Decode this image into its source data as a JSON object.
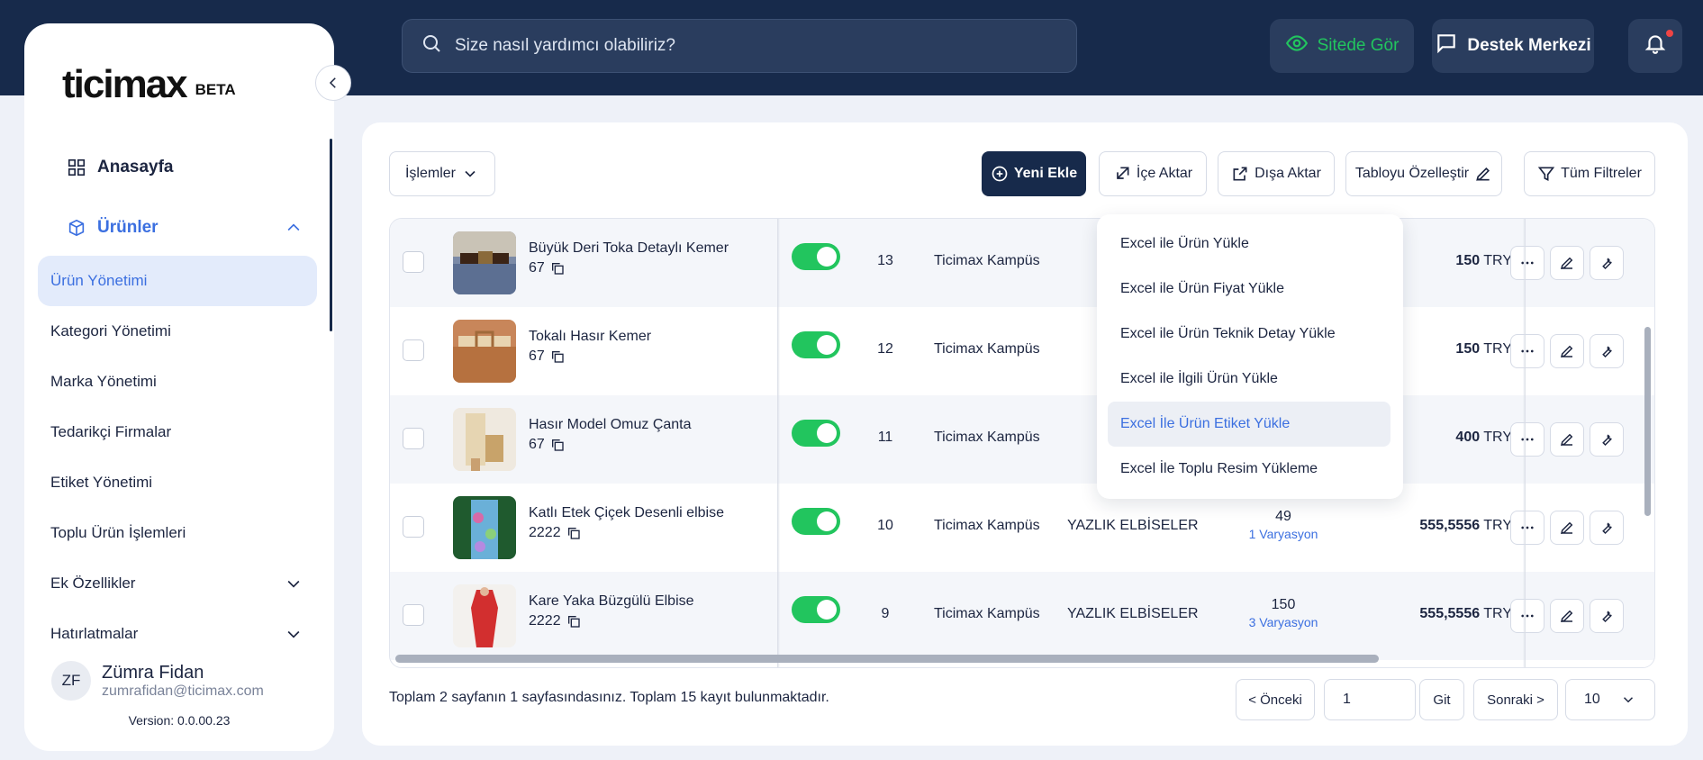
{
  "header": {
    "search_placeholder": "Size nasıl yardımcı olabiliriz?",
    "site_button": "Sitede Gör",
    "support_button": "Destek Merkezi"
  },
  "sidebar": {
    "logo": "ticimax",
    "logo_badge": "BETA",
    "nav": [
      {
        "label": "Anasayfa"
      },
      {
        "label": "Ürünler"
      },
      {
        "label": "Ürün Yönetimi"
      },
      {
        "label": "Kategori Yönetimi"
      },
      {
        "label": "Marka Yönetimi"
      },
      {
        "label": "Tedarikçi Firmalar"
      },
      {
        "label": "Etiket Yönetimi"
      },
      {
        "label": "Toplu Ürün İşlemleri"
      },
      {
        "label": "Ek Özellikler"
      },
      {
        "label": "Hatırlatmalar"
      }
    ],
    "user": {
      "initials": "ZF",
      "name": "Zümra Fidan",
      "email": "zumrafidan@ticimax.com"
    },
    "version": "Version: 0.0.00.23"
  },
  "toolbar": {
    "actions_label": "İşlemler",
    "new_label": "Yeni Ekle",
    "import_label": "İçe Aktar",
    "export_label": "Dışa Aktar",
    "customize_label": "Tabloyu Özelleştir",
    "filters_label": "Tüm Filtreler"
  },
  "import_menu": [
    "Excel ile Ürün Yükle",
    "Excel ile Ürün Fiyat Yükle",
    "Excel ile Ürün Teknik Detay Yükle",
    "Excel ile İlgili Ürün Yükle",
    "Excel İle Ürün Etiket Yükle",
    "Excel İle Toplu Resim Yükleme"
  ],
  "products": [
    {
      "name": "Büyük Deri Toka Detaylı Kemer",
      "code": "67",
      "id": "13",
      "store": "Ticimax Kampüs",
      "category": "",
      "stock": "",
      "variants": "",
      "price": "150",
      "currency": "TRY"
    },
    {
      "name": "Tokalı Hasır Kemer",
      "code": "67",
      "id": "12",
      "store": "Ticimax Kampüs",
      "category": "",
      "stock": "",
      "variants": "",
      "price": "150",
      "currency": "TRY"
    },
    {
      "name": "Hasır Model Omuz Çanta",
      "code": "67",
      "id": "11",
      "store": "Ticimax Kampüs",
      "category": "",
      "stock": "",
      "variants": "",
      "price": "400",
      "currency": "TRY"
    },
    {
      "name": "Katlı Etek Çiçek Desenli elbise",
      "code": "2222",
      "id": "10",
      "store": "Ticimax Kampüs",
      "category": "YAZLIK ELBİSELER",
      "stock": "49",
      "variants": "1 Varyasyon",
      "price": "555,5556",
      "currency": "TRY"
    },
    {
      "name": "Kare Yaka Büzgülü Elbise",
      "code": "2222",
      "id": "9",
      "store": "Ticimax Kampüs",
      "category": "YAZLIK ELBİSELER",
      "stock": "150",
      "variants": "3 Varyasyon",
      "price": "555,5556",
      "currency": "TRY"
    }
  ],
  "pagination": {
    "summary": "Toplam 2 sayfanın 1 sayfasındasınız. Toplam 15 kayıt bulunmaktadır.",
    "prev_label": "< Önceki",
    "page_value": "1",
    "go_label": "Git",
    "next_label": "Sonraki >",
    "page_size": "10"
  },
  "colors": {
    "navy": "#172a4b",
    "accent_blue": "#3b6fe0",
    "success_green": "#22c55e"
  }
}
